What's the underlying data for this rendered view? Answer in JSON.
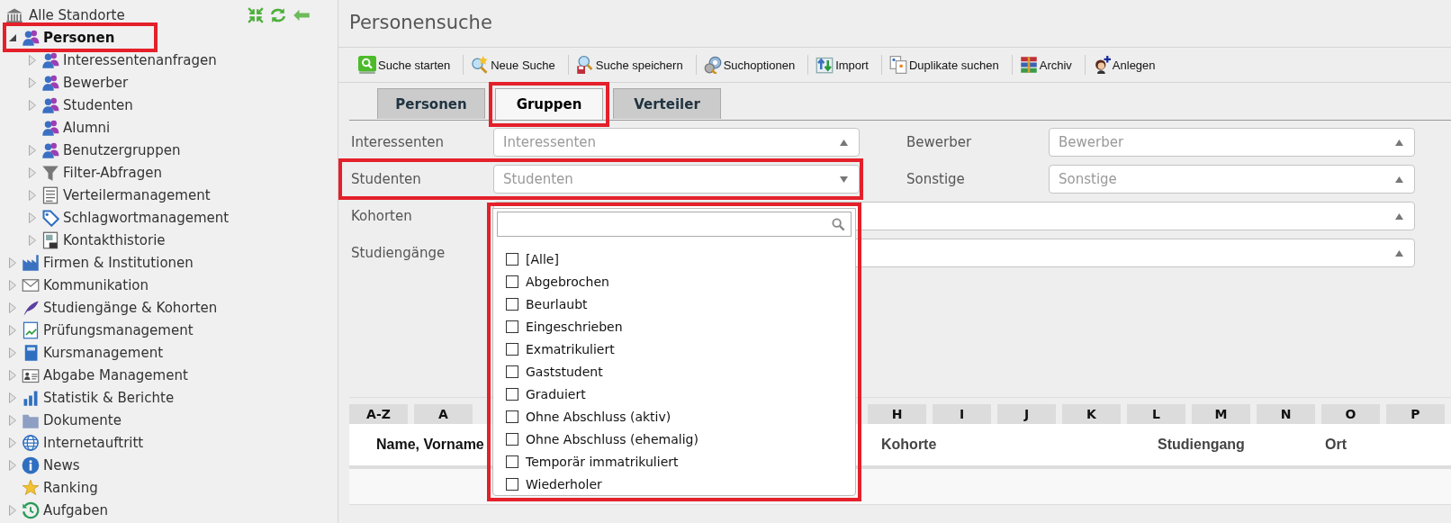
{
  "sidebar": {
    "root": "Alle Standorte",
    "items": [
      {
        "label": "Personen",
        "expandable": true,
        "expanded": true,
        "selected": true,
        "highlighted": true,
        "children": [
          {
            "label": "Interessentenanfragen",
            "expandable": true,
            "expanded": false,
            "selected": false,
            "highlighted": false
          },
          {
            "label": "Bewerber",
            "expandable": true,
            "expanded": false,
            "selected": false,
            "highlighted": false
          },
          {
            "label": "Studenten",
            "expandable": true,
            "expanded": false,
            "selected": false,
            "highlighted": false
          },
          {
            "label": "Alumni",
            "expandable": false,
            "selected": false,
            "highlighted": false
          },
          {
            "label": "Benutzergruppen",
            "expandable": true,
            "expanded": false,
            "selected": false,
            "highlighted": false
          },
          {
            "label": "Filter-Abfragen",
            "expandable": true,
            "expanded": false,
            "selected": false,
            "highlighted": false
          },
          {
            "label": "Verteilermanagement",
            "expandable": true,
            "expanded": false,
            "selected": false,
            "highlighted": false
          },
          {
            "label": "Schlagwortmanagement",
            "expandable": true,
            "expanded": false,
            "selected": false,
            "highlighted": false
          },
          {
            "label": "Kontakthistorie",
            "expandable": true,
            "expanded": false,
            "selected": false,
            "highlighted": false
          }
        ]
      },
      {
        "label": "Firmen & Institutionen",
        "expandable": true,
        "expanded": false,
        "selected": false,
        "highlighted": false
      },
      {
        "label": "Kommunikation",
        "expandable": true,
        "expanded": false,
        "selected": false,
        "highlighted": false
      },
      {
        "label": "Studiengänge & Kohorten",
        "expandable": true,
        "expanded": false,
        "selected": false,
        "highlighted": false
      },
      {
        "label": "Prüfungsmanagement",
        "expandable": true,
        "expanded": false,
        "selected": false,
        "highlighted": false
      },
      {
        "label": "Kursmanagement",
        "expandable": true,
        "expanded": false,
        "selected": false,
        "highlighted": false
      },
      {
        "label": "Abgabe Management",
        "expandable": true,
        "expanded": false,
        "selected": false,
        "highlighted": false
      },
      {
        "label": "Statistik & Berichte",
        "expandable": true,
        "expanded": false,
        "selected": false,
        "highlighted": false
      },
      {
        "label": "Dokumente",
        "expandable": true,
        "expanded": false,
        "selected": false,
        "highlighted": false
      },
      {
        "label": "Internetauftritt",
        "expandable": true,
        "expanded": false,
        "selected": false,
        "highlighted": false
      },
      {
        "label": "News",
        "expandable": true,
        "expanded": false,
        "selected": false,
        "highlighted": false
      },
      {
        "label": "Ranking",
        "expandable": false,
        "selected": false,
        "highlighted": false
      },
      {
        "label": "Aufgaben",
        "expandable": true,
        "expanded": false,
        "selected": false,
        "highlighted": false
      }
    ]
  },
  "page_title": "Personensuche",
  "toolbar": [
    "Suche starten",
    "Neue Suche",
    "Suche speichern",
    "Suchoptionen",
    "Import",
    "Duplikate suchen",
    "Archiv",
    "Anlegen"
  ],
  "tabs": [
    {
      "label": "Personen",
      "selected": false,
      "highlighted": false
    },
    {
      "label": "Gruppen",
      "selected": true,
      "highlighted": true
    },
    {
      "label": "Verteiler",
      "selected": false,
      "highlighted": false
    }
  ],
  "filters": [
    {
      "kind": "half",
      "label": "Interessenten",
      "placeholder": "Interessenten",
      "open": false,
      "highlighted": false
    },
    {
      "kind": "half",
      "label": "Bewerber",
      "placeholder": "Bewerber",
      "open": false,
      "highlighted": false
    },
    {
      "kind": "half",
      "label": "Studenten",
      "placeholder": "Studenten",
      "open": true,
      "highlighted": true,
      "options": [
        {
          "label": "[Alle]",
          "checked": false
        },
        {
          "label": "Abgebrochen",
          "checked": false
        },
        {
          "label": "Beurlaubt",
          "checked": false
        },
        {
          "label": "Eingeschrieben",
          "checked": false
        },
        {
          "label": "Exmatrikuliert",
          "checked": false
        },
        {
          "label": "Gaststudent",
          "checked": false
        },
        {
          "label": "Graduiert",
          "checked": false
        },
        {
          "label": "Ohne Abschluss (aktiv)",
          "checked": false
        },
        {
          "label": "Ohne Abschluss (ehemalig)",
          "checked": false
        },
        {
          "label": "Temporär immatrikuliert",
          "checked": false
        },
        {
          "label": "Wiederholer",
          "checked": false
        }
      ]
    },
    {
      "kind": "half",
      "label": "Sonstige",
      "placeholder": "Sonstige",
      "open": false,
      "highlighted": false
    },
    {
      "kind": "wide",
      "label": "Kohorten",
      "open": false,
      "highlighted": false
    },
    {
      "kind": "wide",
      "label": "Studiengänge",
      "open": false,
      "highlighted": false
    }
  ],
  "alphabet": {
    "left": [
      "A-Z",
      "A"
    ],
    "right": [
      "H",
      "I",
      "J",
      "K",
      "L",
      "M",
      "N",
      "O",
      "P"
    ]
  },
  "table": {
    "columns": [
      "Name, Vorname",
      "Kohorte",
      "Studiengang",
      "Ort"
    ]
  }
}
